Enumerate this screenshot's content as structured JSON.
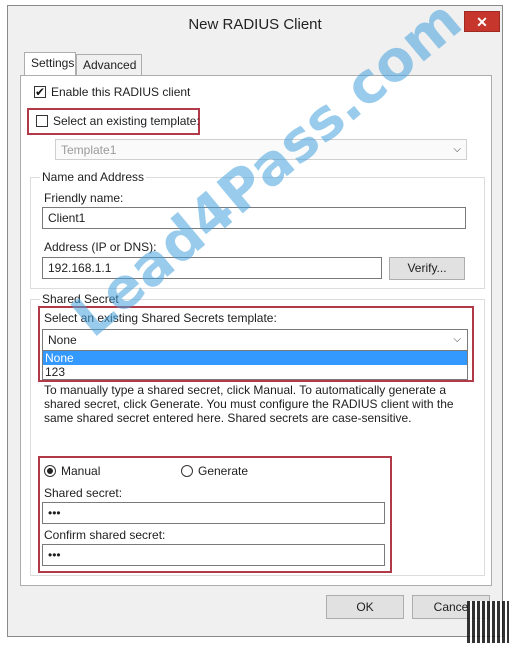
{
  "window": {
    "title": "New RADIUS Client",
    "close_glyph": "✕"
  },
  "tabs": [
    {
      "label": "Settings",
      "active": true
    },
    {
      "label": "Advanced",
      "active": false
    }
  ],
  "enable_client": {
    "label": "Enable this RADIUS client",
    "checked": true
  },
  "existing_template": {
    "label": "Select an existing template:",
    "checked": false,
    "value": "Template1"
  },
  "name_address": {
    "group_label": "Name and Address",
    "friendly_label": "Friendly name:",
    "friendly_value": "Client1",
    "address_label": "Address (IP or DNS):",
    "address_value": "192.168.1.1",
    "verify_label": "Verify..."
  },
  "shared_secret": {
    "group_label": "Shared Secret",
    "template_label": "Select an existing Shared Secrets template:",
    "template_value": "None",
    "options": [
      "None",
      "123"
    ],
    "selected_option": "None",
    "help_text": "To manually type a shared secret, click Manual. To automatically generate a shared secret, click Generate. You must configure the RADIUS client with the same shared secret entered here. Shared secrets are case-sensitive.",
    "manual_label": "Manual",
    "generate_label": "Generate",
    "mode": "Manual",
    "secret_label": "Shared secret:",
    "secret_value": "•••",
    "confirm_label": "Confirm shared secret:",
    "confirm_value": "•••"
  },
  "buttons": {
    "ok": "OK",
    "cancel": "Cance"
  },
  "watermark": "Lead4Pass.com",
  "colors": {
    "highlight_border": "#b23a48",
    "selection": "#3399ff",
    "close": "#c7362c",
    "watermark": "#46a0dc"
  }
}
